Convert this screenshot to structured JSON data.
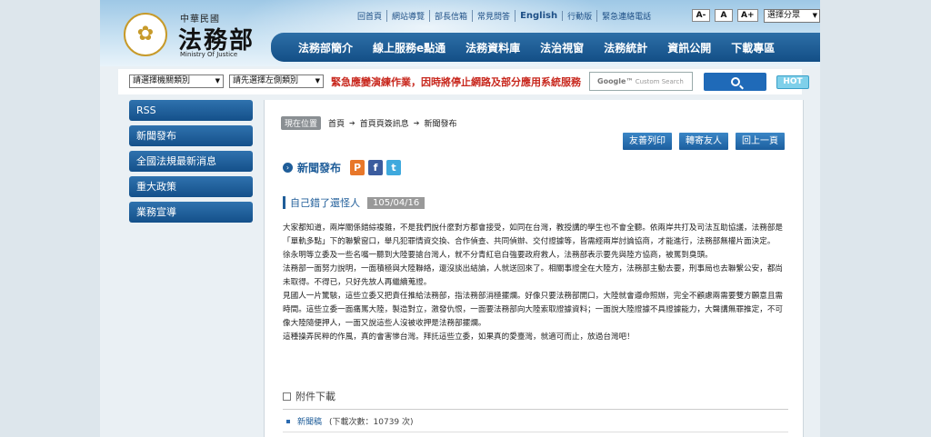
{
  "header": {
    "emblem_glyph": "✿",
    "logo_subtitle": "中華民國",
    "logo_title": "法務部",
    "logo_english": "Ministry Of Justice",
    "top_links": [
      "回首頁",
      "網站導覽",
      "部長信箱",
      "常見問答",
      "English",
      "行動版",
      "緊急連絡電話"
    ],
    "font_buttons": [
      "A-",
      "A",
      "A+"
    ],
    "category_select": "選擇分眾",
    "nav": [
      "法務部簡介",
      "線上服務e點通",
      "法務資料庫",
      "法治視窗",
      "法務統計",
      "資訊公開",
      "下載專區"
    ]
  },
  "search": {
    "org_select": "請選擇機關類別",
    "left_select": "請先選擇左側類別",
    "marquee": "緊急應變演練作業，因時將停止網路及部分應用系統服務",
    "google_brand": "Google™",
    "google_placeholder": "Custom Search",
    "hot": "HOT"
  },
  "sidebar": {
    "items": [
      "RSS",
      "新聞發布",
      "全國法規最新消息",
      "重大政策",
      "業務宣導"
    ]
  },
  "breadcrumb": {
    "here": "現在位置",
    "items": [
      "首頁",
      "首頁頁簽訊息",
      "新聞發布"
    ]
  },
  "actions": [
    "友善列印",
    "轉寄友人",
    "回上一頁"
  ],
  "section": {
    "title": "新聞發布",
    "social": [
      "P",
      "f",
      "t"
    ]
  },
  "article": {
    "title": "自己錯了還怪人",
    "date": "105/04/16",
    "paragraphs": [
      "大家都知道，兩岸關係錯綜複雜，不是我們說什麼對方都會接受，如同在台灣，教授講的學生也不會全聽。依兩岸共打及司法互助協議，法務部是「單軌多點」下的聯繫窗口，舉凡犯罪情資交換、合作偵查、共同偵辦、交付證據等，皆需經兩岸討論協商，才能進行，法務部無權片面決定。",
      "徐永明等立委及一些名嘴一聽到大陸要搶台灣人，就不分青紅皂白強要政府救人，法務部表示要先與陸方協商，被罵到臭頭。",
      "法務部一面努力說明，一面積極與大陸聯絡，還沒談出結論，人就送回來了。相關事證全在大陸方，法務部主動去要，刑事局也去聯繫公安，都尚未取得。不得已，只好先放人再繼續蒐證。",
      "見國人一片驚駭，這些立委又把責任推給法務部，指法務部消極擺爛。好像只要法務部開口，大陸就會遵命照辦，完全不顧慮兩需要雙方願意且需時間。這些立委一面痛罵大陸，製造對立，激發仇恨，一面要法務部向大陸索取證據資料；一面說大陸證據不具證據能力，大聲講無罪推定，不可像大陸隨便押人，一面又說這些人沒被收押是法務部擺爛。",
      "這種操弄民粹的作風，真的會害慘台灣。拜託這些立委，如果真的愛臺灣，就適可而止，放過台灣吧！"
    ]
  },
  "attachment": {
    "heading": "附件下載",
    "name": "新聞稿",
    "count": "(下載次數：10739 次)"
  }
}
